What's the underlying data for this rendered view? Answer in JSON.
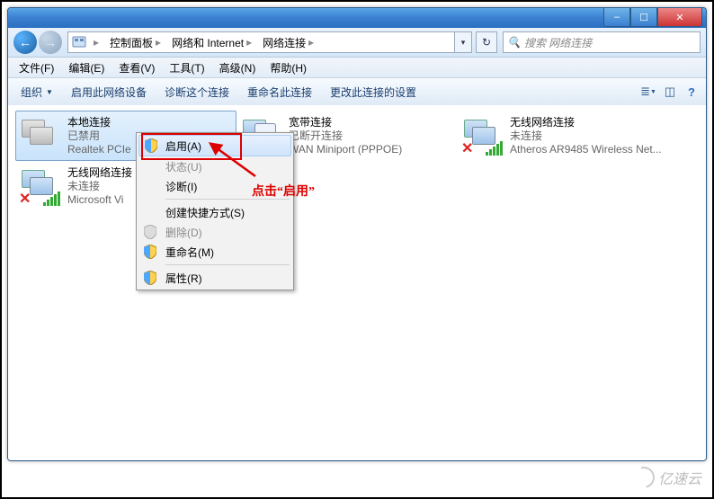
{
  "window": {
    "controls": {
      "min": "–",
      "max": "☐",
      "close": "✕"
    }
  },
  "nav": {
    "back": "←",
    "forward": "→"
  },
  "breadcrumb": {
    "icon_hint": "control-panel-icon",
    "items": [
      "控制面板",
      "网络和 Internet",
      "网络连接"
    ],
    "dropdown_glyph": "▾",
    "refresh_glyph": "↻"
  },
  "search": {
    "placeholder": "搜索 网络连接",
    "icon": "🔍"
  },
  "menubar": [
    "文件(F)",
    "编辑(E)",
    "查看(V)",
    "工具(T)",
    "高级(N)",
    "帮助(H)"
  ],
  "toolbar": {
    "organize": "组织",
    "items": [
      "启用此网络设备",
      "诊断这个连接",
      "重命名此连接",
      "更改此连接的设置"
    ],
    "right_icons": [
      "view-icon",
      "preview-pane-icon",
      "help-icon"
    ]
  },
  "connections": [
    {
      "name": "本地连接",
      "status": "已禁用",
      "device": "Realtek PCIe",
      "icon": "nic-disabled",
      "selected": true
    },
    {
      "name": "宽带连接",
      "status": "已断开连接",
      "device": "WAN Miniport (PPPOE)",
      "icon": "dialup"
    },
    {
      "name": "无线网络连接",
      "status": "未连接",
      "device": "Atheros AR9485 Wireless Net...",
      "icon": "wifi-x"
    },
    {
      "name": "无线网络连接",
      "status": "未连接",
      "device": "Microsoft Vi",
      "icon": "wifi-x"
    }
  ],
  "context_menu": {
    "items": [
      {
        "label": "启用(A)",
        "shield": true,
        "highlight": true
      },
      {
        "label": "状态(U)",
        "disabled": true
      },
      {
        "label": "诊断(I)"
      },
      {
        "sep": true
      },
      {
        "label": "创建快捷方式(S)"
      },
      {
        "label": "删除(D)",
        "shield": true,
        "disabled": true
      },
      {
        "label": "重命名(M)",
        "shield": true
      },
      {
        "sep": true
      },
      {
        "label": "属性(R)",
        "shield": true
      }
    ]
  },
  "annotation": {
    "text": "点击“启用”"
  },
  "watermark": "亿速云"
}
